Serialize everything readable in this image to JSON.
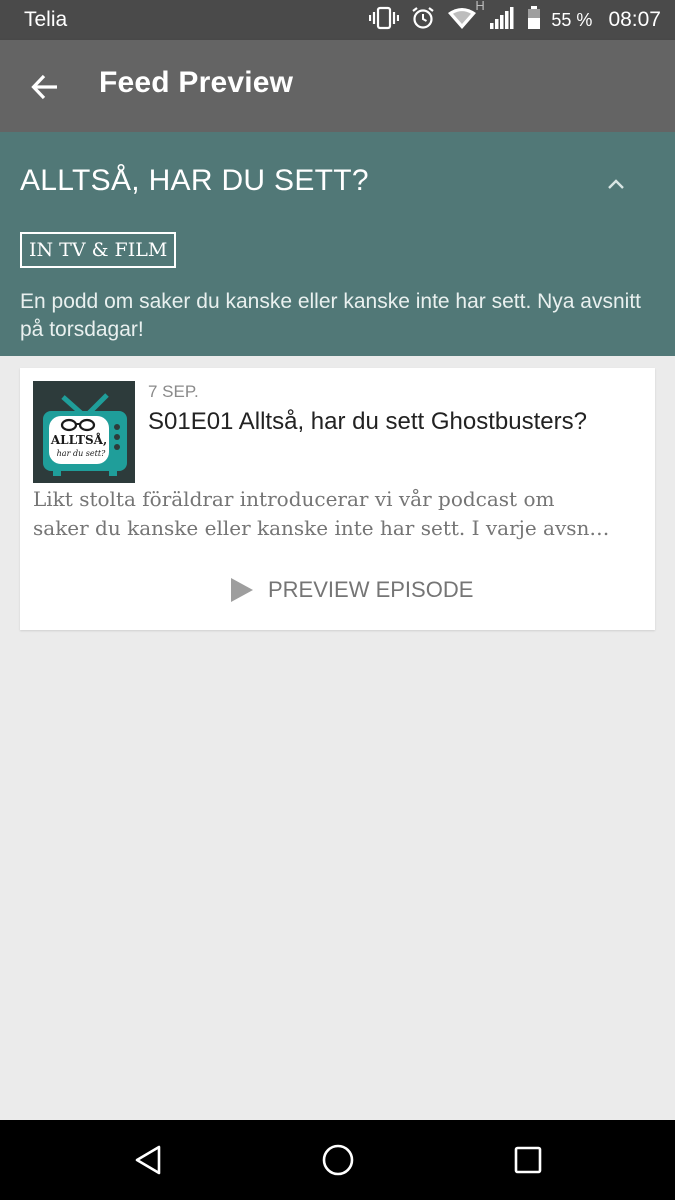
{
  "status_bar": {
    "carrier": "Telia",
    "network_type": "H",
    "battery_percent": "55 %",
    "time": "08:07",
    "icons": [
      "vibrate-icon",
      "alarm-icon",
      "wifi-icon",
      "signal-icon",
      "battery-icon"
    ]
  },
  "app_bar": {
    "title": "Feed Preview",
    "back_icon": "arrow-left-icon",
    "background_color": "#646464"
  },
  "feed": {
    "title": "ALLTSÅ, HAR DU SETT?",
    "category": "IN TV & FILM",
    "description": "En podd om saker du kanske eller kanske inte har sett. Nya avsnitt på torsdagar!",
    "collapse_icon": "chevron-up-icon",
    "header_color": "#517877"
  },
  "episode": {
    "date": "7 SEP.",
    "title": "S01E01 Alltså, har du sett Ghostbusters?",
    "description_lines": [
      "Likt stolta föräldrar introducerar vi vår podcast om",
      "saker du kanske eller kanske inte har sett. I varje avsn…"
    ],
    "artwork": {
      "text_line_1": "ALLTSÅ,",
      "text_line_2": "har du sett?",
      "accent_color": "#1f9e9a"
    },
    "preview_label": "PREVIEW EPISODE",
    "preview_icon": "play-icon"
  },
  "nav_bar": {
    "icons": [
      "nav-back-icon",
      "nav-home-icon",
      "nav-recents-icon"
    ]
  }
}
